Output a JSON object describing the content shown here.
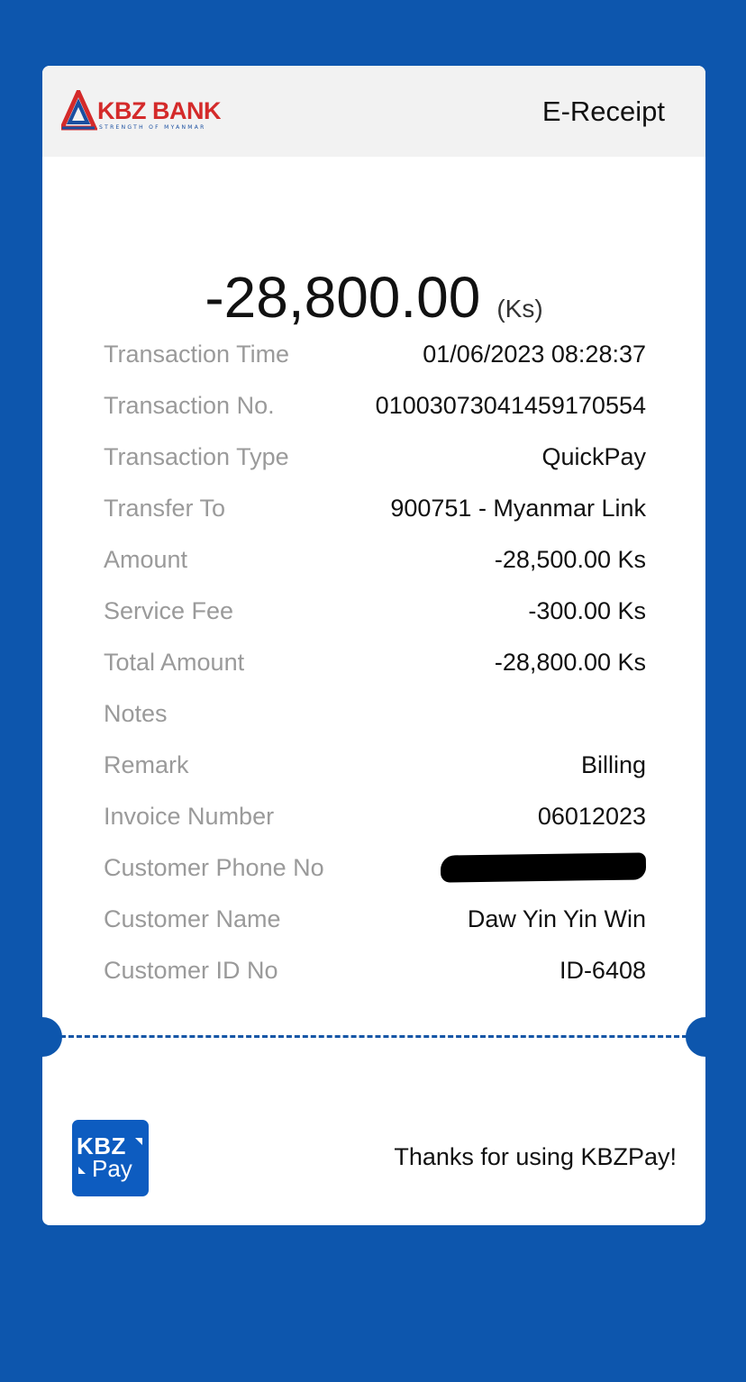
{
  "header": {
    "bank_name": "KBZ BANK",
    "bank_tagline": "STRENGTH OF MYANMAR",
    "title": "E-Receipt"
  },
  "summary": {
    "amount": "-28,800.00",
    "unit": "(Ks)"
  },
  "details": [
    {
      "label": "Transaction Time",
      "value": "01/06/2023 08:28:37"
    },
    {
      "label": "Transaction No.",
      "value": "01003073041459170554"
    },
    {
      "label": "Transaction Type",
      "value": "QuickPay"
    },
    {
      "label": "Transfer To",
      "value": "900751 - Myanmar Link"
    },
    {
      "label": "Amount",
      "value": "-28,500.00 Ks"
    },
    {
      "label": "Service Fee",
      "value": "-300.00 Ks"
    },
    {
      "label": "Total Amount",
      "value": "-28,800.00 Ks"
    },
    {
      "label": "Notes",
      "value": ""
    },
    {
      "label": "Remark",
      "value": "Billing"
    },
    {
      "label": "Invoice Number",
      "value": "06012023"
    },
    {
      "label": "Customer Phone No",
      "value": ""
    },
    {
      "label": "Customer Name",
      "value": "Daw Yin Yin Win"
    },
    {
      "label": "Customer ID No",
      "value": "ID-6408"
    }
  ],
  "footer": {
    "pay_logo_top": "KBZ",
    "pay_logo_bottom": "Pay",
    "thanks": "Thanks for using KBZPay!"
  },
  "colors": {
    "background": "#0d56ad",
    "brand_red": "#d42a2a",
    "brand_blue": "#1a4fa0",
    "label_gray": "#9a9a9a"
  }
}
